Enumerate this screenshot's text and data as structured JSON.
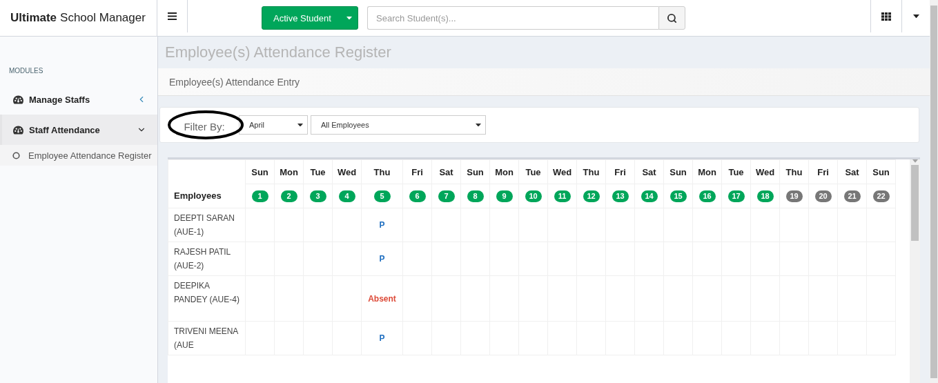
{
  "brand": {
    "bold": "Ultimate",
    "rest": "School Manager"
  },
  "topbar": {
    "student_button": "Active Student",
    "search": {
      "placeholder": "Search Student(s)..."
    }
  },
  "sidebar": {
    "heading": "MODULES",
    "items": [
      {
        "label": "Manage Staffs",
        "expanded": false,
        "selected": false
      },
      {
        "label": "Staff Attendance",
        "expanded": true,
        "selected": true,
        "children": [
          {
            "label": "Employee Attendance Register"
          }
        ]
      }
    ]
  },
  "page_title": "Employee(s) Attendance Register",
  "panel_title": "Employee(s) Attendance Entry",
  "filter": {
    "label": "Filter By:",
    "month": "April",
    "employee": "All Employees"
  },
  "table": {
    "first_column": "Employees",
    "days": [
      {
        "weekday": "Sun",
        "date": "1",
        "color": "#00a65a"
      },
      {
        "weekday": "Mon",
        "date": "2",
        "color": "#00a65a"
      },
      {
        "weekday": "Tue",
        "date": "3",
        "color": "#00a65a"
      },
      {
        "weekday": "Wed",
        "date": "4",
        "color": "#00a65a"
      },
      {
        "weekday": "Thu",
        "date": "5",
        "color": "#00a65a"
      },
      {
        "weekday": "Fri",
        "date": "6",
        "color": "#00a65a"
      },
      {
        "weekday": "Sat",
        "date": "7",
        "color": "#00a65a"
      },
      {
        "weekday": "Sun",
        "date": "8",
        "color": "#00a65a"
      },
      {
        "weekday": "Mon",
        "date": "9",
        "color": "#00a65a"
      },
      {
        "weekday": "Tue",
        "date": "10",
        "color": "#00a65a"
      },
      {
        "weekday": "Wed",
        "date": "11",
        "color": "#00a65a"
      },
      {
        "weekday": "Thu",
        "date": "12",
        "color": "#00a65a"
      },
      {
        "weekday": "Fri",
        "date": "13",
        "color": "#00a65a"
      },
      {
        "weekday": "Sat",
        "date": "14",
        "color": "#00a65a"
      },
      {
        "weekday": "Sun",
        "date": "15",
        "color": "#00a65a"
      },
      {
        "weekday": "Mon",
        "date": "16",
        "color": "#00a65a"
      },
      {
        "weekday": "Tue",
        "date": "17",
        "color": "#00a65a"
      },
      {
        "weekday": "Wed",
        "date": "18",
        "color": "#00a65a"
      },
      {
        "weekday": "Thu",
        "date": "19",
        "color": "#777777"
      },
      {
        "weekday": "Fri",
        "date": "20",
        "color": "#777777"
      },
      {
        "weekday": "Sat",
        "date": "21",
        "color": "#777777"
      },
      {
        "weekday": "Sun",
        "date": "22",
        "color": "#777777"
      }
    ],
    "rows": [
      {
        "name": "DEEPTI SARAN (AUE-1)",
        "cells": [
          {
            "kind": "blank"
          },
          {
            "kind": "blank"
          },
          {
            "kind": "blank"
          },
          {
            "kind": "blank"
          },
          {
            "kind": "present",
            "text": "P"
          },
          {
            "kind": "blank"
          },
          {
            "kind": "blank"
          },
          {
            "kind": "blank"
          },
          {
            "kind": "blank"
          },
          {
            "kind": "blank"
          },
          {
            "kind": "blank"
          },
          {
            "kind": "blank"
          },
          {
            "kind": "blank"
          },
          {
            "kind": "blank"
          },
          {
            "kind": "blank"
          },
          {
            "kind": "blank"
          },
          {
            "kind": "blank"
          },
          {
            "kind": "blank"
          },
          {
            "kind": "blank"
          },
          {
            "kind": "blank"
          },
          {
            "kind": "blank"
          },
          {
            "kind": "blank"
          }
        ]
      },
      {
        "name": "RAJESH PATIL (AUE-2)",
        "cells": [
          {
            "kind": "blank"
          },
          {
            "kind": "blank"
          },
          {
            "kind": "blank"
          },
          {
            "kind": "blank"
          },
          {
            "kind": "present",
            "text": "P"
          },
          {
            "kind": "blank"
          },
          {
            "kind": "blank"
          },
          {
            "kind": "blank"
          },
          {
            "kind": "blank"
          },
          {
            "kind": "blank"
          },
          {
            "kind": "blank"
          },
          {
            "kind": "blank"
          },
          {
            "kind": "blank"
          },
          {
            "kind": "blank"
          },
          {
            "kind": "blank"
          },
          {
            "kind": "blank"
          },
          {
            "kind": "blank"
          },
          {
            "kind": "blank"
          },
          {
            "kind": "blank"
          },
          {
            "kind": "blank"
          },
          {
            "kind": "blank"
          },
          {
            "kind": "blank"
          }
        ]
      },
      {
        "name": "DEEPIKA PANDEY (AUE-4)",
        "cells": [
          {
            "kind": "blank"
          },
          {
            "kind": "blank"
          },
          {
            "kind": "blank"
          },
          {
            "kind": "blank"
          },
          {
            "kind": "absent",
            "text": "Absent"
          },
          {
            "kind": "blank"
          },
          {
            "kind": "blank"
          },
          {
            "kind": "blank"
          },
          {
            "kind": "blank"
          },
          {
            "kind": "blank"
          },
          {
            "kind": "blank"
          },
          {
            "kind": "blank"
          },
          {
            "kind": "blank"
          },
          {
            "kind": "blank"
          },
          {
            "kind": "blank"
          },
          {
            "kind": "blank"
          },
          {
            "kind": "blank"
          },
          {
            "kind": "blank"
          },
          {
            "kind": "blank"
          },
          {
            "kind": "blank"
          },
          {
            "kind": "blank"
          },
          {
            "kind": "blank"
          }
        ]
      },
      {
        "name": "TRIVENI MEENA (AUE",
        "cells": [
          {
            "kind": "blank"
          },
          {
            "kind": "blank"
          },
          {
            "kind": "blank"
          },
          {
            "kind": "blank"
          },
          {
            "kind": "present",
            "text": "P"
          },
          {
            "kind": "blank"
          },
          {
            "kind": "blank"
          },
          {
            "kind": "blank"
          },
          {
            "kind": "blank"
          },
          {
            "kind": "blank"
          },
          {
            "kind": "blank"
          },
          {
            "kind": "blank"
          },
          {
            "kind": "blank"
          },
          {
            "kind": "blank"
          },
          {
            "kind": "blank"
          },
          {
            "kind": "blank"
          },
          {
            "kind": "blank"
          },
          {
            "kind": "blank"
          },
          {
            "kind": "blank"
          },
          {
            "kind": "blank"
          },
          {
            "kind": "blank"
          },
          {
            "kind": "blank"
          }
        ]
      }
    ]
  }
}
